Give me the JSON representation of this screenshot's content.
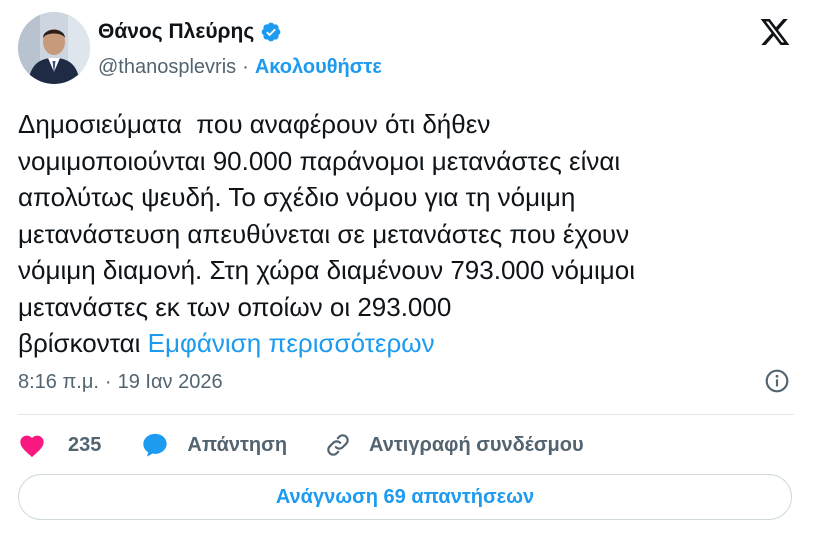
{
  "author": {
    "display_name": "Θάνος Πλεύρης",
    "handle": "@thanosplevris",
    "separator": "·",
    "follow_label": "Ακολουθήστε",
    "verified": true
  },
  "tweet": {
    "lines": [
      "Δημοσιεύματα  που αναφέρουν ότι δήθεν",
      "νομιμοποιούνται 90.000 παράνομοι μετανάστες είναι",
      "απολύτως ψευδή. Το σχέδιο νόμου για τη νόμιμη",
      "μετανάστευση απευθύνεται σε μετανάστες που έχουν",
      "νόμιμη διαμονή. Στη χώρα διαμένουν 793.000 νόμιμοι",
      "μετανάστες εκ των οποίων οι 293.000"
    ],
    "last_line": "βρίσκονται ",
    "show_more_label": "Εμφάνιση περισσότερων"
  },
  "meta": {
    "time": "8:16 π.μ.",
    "separator": "·",
    "date": "19 Ιαν 2026"
  },
  "actions": {
    "like_count": "235",
    "reply_label": "Απάντηση",
    "copy_link_label": "Αντιγραφή συνδέσμου"
  },
  "read_replies_label": "Ανάγνωση 69 απαντήσεων",
  "colors": {
    "accent": "#1d9bf0",
    "like": "#f91880",
    "text": "#0f1419",
    "secondary": "#536471"
  },
  "icons": [
    "x-logo-icon",
    "verified-badge-icon",
    "info-icon",
    "heart-icon",
    "reply-bubble-icon",
    "link-icon"
  ]
}
